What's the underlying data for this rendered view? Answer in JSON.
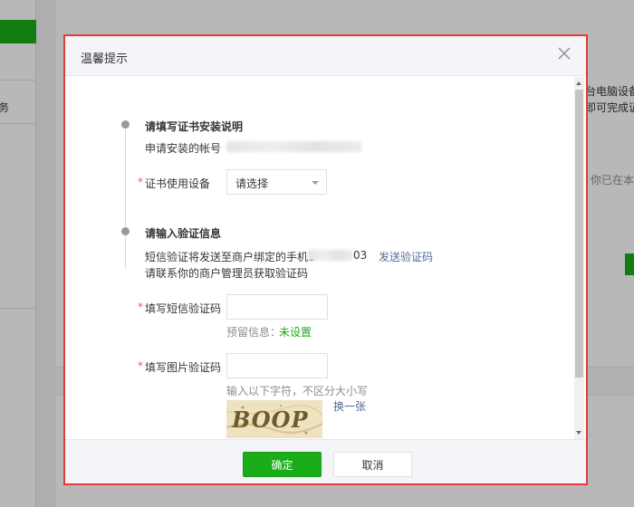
{
  "background": {
    "sidebar_text": "务",
    "right_text_1": "台电脑设备",
    "right_text_2": "即可完成证",
    "right_text_3": "你已在本"
  },
  "dialog": {
    "title": "温馨提示",
    "close_icon": "close-icon",
    "step1": {
      "title": "请填写证书安装说明",
      "account_label": "申请安装的帐号",
      "device_label": "证书使用设备",
      "device_select_value": "请选择",
      "required_mark": "*"
    },
    "step2": {
      "title": "请输入验证信息",
      "sms_notice_prefix": "短信验证将发送至商户绑定的手机1",
      "sms_notice_suffix": "03",
      "send_code_link": "发送验证码",
      "admin_notice": "请联系你的商户管理员获取验证码",
      "sms_code_label": "填写短信验证码",
      "sms_code_value": "",
      "reserved_info_label": "预留信息：",
      "reserved_info_value": "未设置",
      "image_code_label": "填写图片验证码",
      "image_code_value": "",
      "image_code_hint": "输入以下字符，不区分大小写",
      "captcha_text": "BOOP",
      "refresh_link": "换一张",
      "required_mark": "*"
    },
    "footer": {
      "confirm_label": "确定",
      "cancel_label": "取消"
    }
  },
  "colors": {
    "primary_green": "#1aad19",
    "link_blue": "#576b95",
    "required_red": "#e15f63",
    "dialog_border": "#e23b3b"
  }
}
